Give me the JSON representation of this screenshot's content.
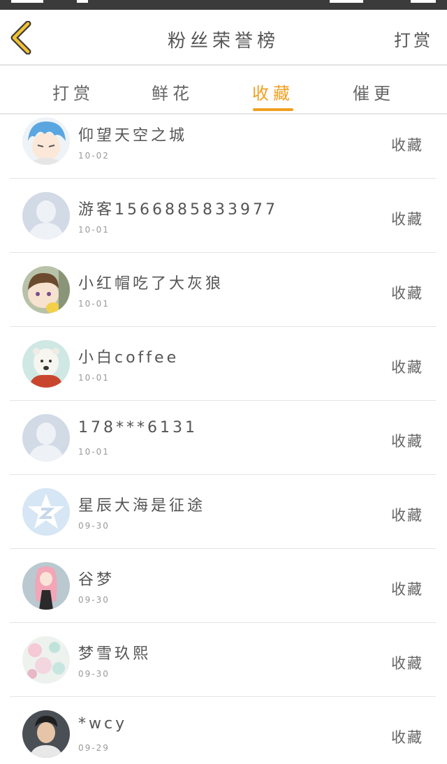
{
  "header": {
    "title": "粉丝荣誉榜",
    "right_action": "打赏"
  },
  "tabs": [
    {
      "label": "打赏"
    },
    {
      "label": "鲜花"
    },
    {
      "label": "收藏"
    },
    {
      "label": "催更"
    }
  ],
  "colors": {
    "accent": "#f0a020",
    "text": "#555555",
    "muted": "#999999",
    "divider": "#e3e3e3"
  },
  "list": [
    {
      "name": "仰望天空之城",
      "date": "10-02",
      "action": "收藏",
      "avatar": "anime-boy-blue-hair"
    },
    {
      "name": "游客1566885833977",
      "date": "10-01",
      "action": "收藏",
      "avatar": "default-avatar"
    },
    {
      "name": "小红帽吃了大灰狼",
      "date": "10-01",
      "action": "收藏",
      "avatar": "anime-child-avatar"
    },
    {
      "name": "小白coffee",
      "date": "10-01",
      "action": "收藏",
      "avatar": "polar-bear-avatar"
    },
    {
      "name": "178***6131",
      "date": "10-01",
      "action": "收藏",
      "avatar": "default-avatar"
    },
    {
      "name": "星辰大海是征途",
      "date": "09-30",
      "action": "收藏",
      "avatar": "qq-star-avatar"
    },
    {
      "name": "谷梦",
      "date": "09-30",
      "action": "收藏",
      "avatar": "anime-girl-pink-avatar"
    },
    {
      "name": "梦雪玖熙",
      "date": "09-30",
      "action": "收藏",
      "avatar": "floral-anime-avatar"
    },
    {
      "name": "*wcy",
      "date": "09-29",
      "action": "收藏",
      "avatar": "photo-boy-avatar"
    }
  ]
}
